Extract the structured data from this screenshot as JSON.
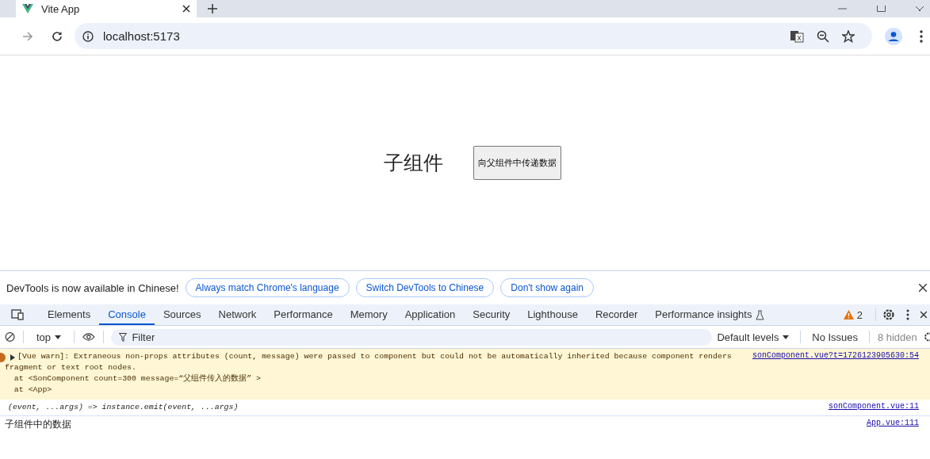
{
  "browser_tab": {
    "title": "Vite App",
    "selected": true
  },
  "address_bar": {
    "url": "localhost:5173"
  },
  "page": {
    "heading": "子组件",
    "button": "向父组件中传递数据"
  },
  "infobar": {
    "message": "DevTools is now available in Chinese!",
    "buttons": [
      "Always match Chrome's language",
      "Switch DevTools to Chinese",
      "Don't show again"
    ]
  },
  "devtools_tabs": [
    {
      "label": "Elements",
      "selected": false
    },
    {
      "label": "Console",
      "selected": true
    },
    {
      "label": "Sources",
      "selected": false
    },
    {
      "label": "Network",
      "selected": false
    },
    {
      "label": "Performance",
      "selected": false
    },
    {
      "label": "Memory",
      "selected": false
    },
    {
      "label": "Application",
      "selected": false
    },
    {
      "label": "Security",
      "selected": false
    },
    {
      "label": "Lighthouse",
      "selected": false
    },
    {
      "label": "Recorder",
      "selected": false
    },
    {
      "label": "Performance insights",
      "selected": false
    }
  ],
  "warning_count": "2",
  "console_toolbar": {
    "context": "top",
    "filter_placeholder": "Filter",
    "levels": "Default levels",
    "issues": "No Issues",
    "hidden": "8 hidden"
  },
  "messages": [
    {
      "kind": "warning",
      "lines": [
        "[Vue warn]: Extraneous non-props attributes (count, message) were passed to component but could not be automatically inherited because component renders",
        "fragment or text root nodes.",
        "  at <SonComponent count=300 message=“父组件传入的数据” >",
        "  at <App>"
      ],
      "source": "sonComponent.vue?t=1726123905630:54"
    },
    {
      "kind": "function",
      "lines": [
        "(event, ...args) => instance.emit(event, ...args)"
      ],
      "source": "sonComponent.vue:11"
    },
    {
      "kind": "log",
      "lines": [
        "子组件中的数据"
      ],
      "source": "App.vue:111"
    }
  ]
}
